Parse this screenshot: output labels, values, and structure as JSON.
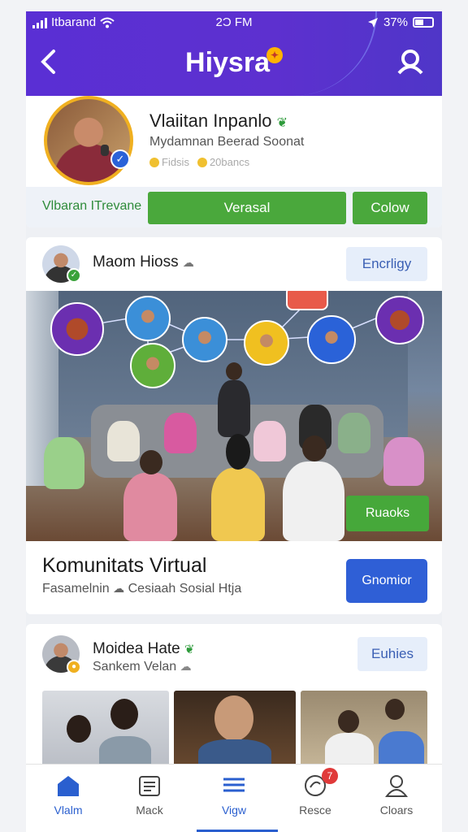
{
  "status": {
    "carrier": "Itbarand",
    "time": "2Ɔ FM",
    "battery": "37%"
  },
  "header": {
    "brand": "Hiysra",
    "brand_badge": "✦"
  },
  "profile": {
    "name": "Vlaiitan Inpanlo",
    "subtitle": "Mydamnan Beerad Soonat",
    "stat1": "Fidsis",
    "stat2": "20bancs",
    "action_label": "Vlbaran ITrevane",
    "btn_primary": "Verasal",
    "btn_secondary": "Colow"
  },
  "post1": {
    "author": "Maom Hioss",
    "follow_label": "Encrligy",
    "overlay_button": "Ruaoks",
    "title": "Komunitats Virtual",
    "subtitle": "Fasamelnin",
    "subtitle2": "Cesiaah Sosial Htja",
    "cta": "Gnomior"
  },
  "post2": {
    "author": "Moidea Hate",
    "subtitle": "Sankem Velan",
    "follow_label": "Euhies"
  },
  "tabs": [
    {
      "label": "Vlalm"
    },
    {
      "label": "Mack"
    },
    {
      "label": "Vigw"
    },
    {
      "label": "Resce",
      "badge": "7"
    },
    {
      "label": "Cloars"
    }
  ],
  "colors": {
    "accent": "#2a5fcf",
    "brand_gradient": "#5a2fd4",
    "green": "#4aa83c"
  }
}
